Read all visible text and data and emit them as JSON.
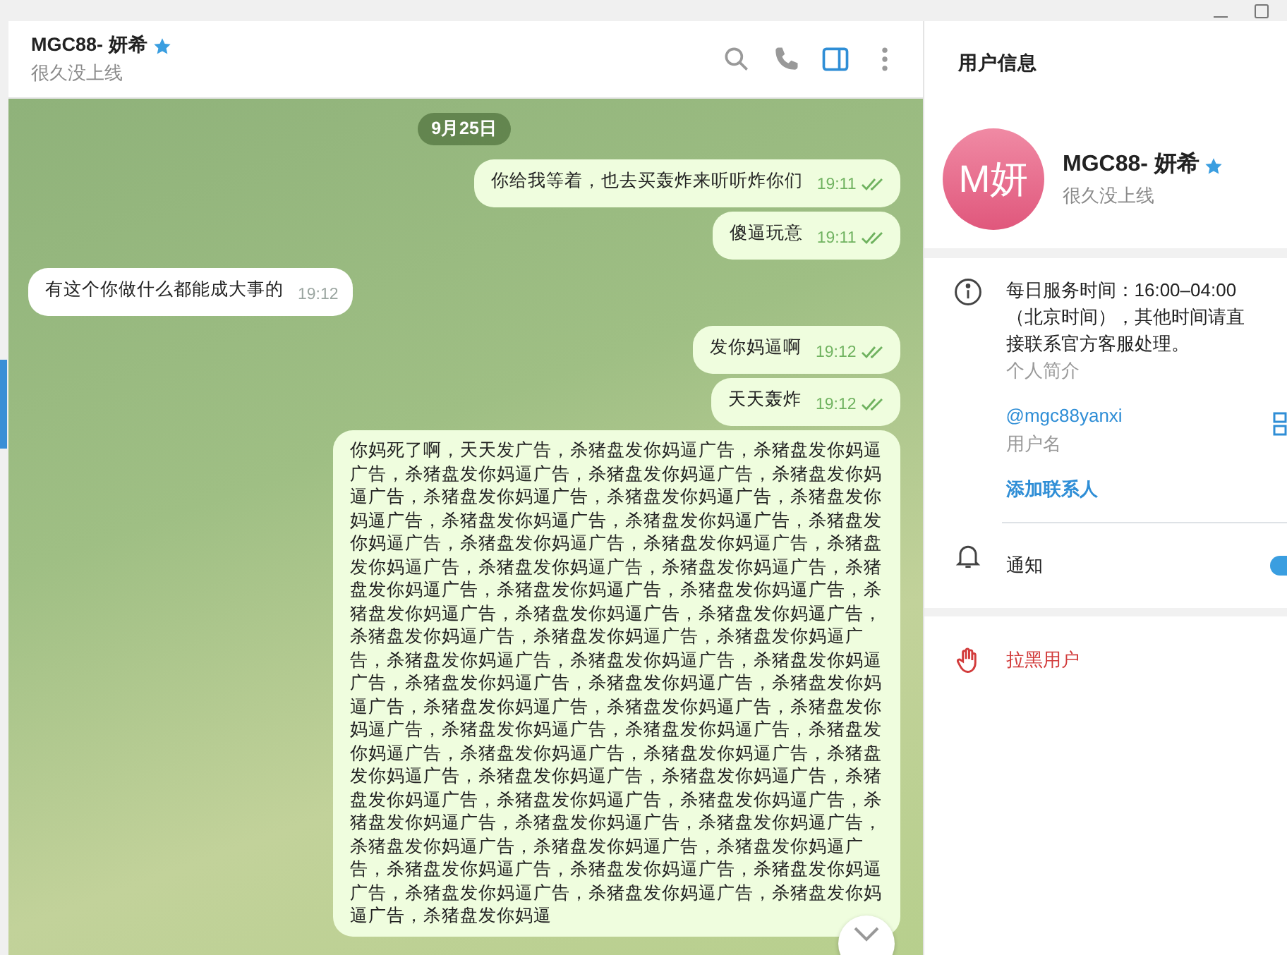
{
  "chat_header": {
    "name": "MGC88- 妍希",
    "verified": true,
    "status": "很久没上线",
    "side_panel_open": true
  },
  "messages": [
    {
      "kind": "date",
      "text": "9月25日"
    },
    {
      "kind": "out",
      "text": "你给我等着，也去买轰炸来听听炸你们",
      "time": "19:11",
      "read": true
    },
    {
      "kind": "out",
      "text": "傻逼玩意",
      "time": "19:11",
      "read": true
    },
    {
      "kind": "in",
      "text": "有这个你做什么都能成大事的",
      "time": "19:12"
    },
    {
      "kind": "out",
      "text": "发你妈逼啊",
      "time": "19:12",
      "read": true
    },
    {
      "kind": "out",
      "text": "天天轰炸",
      "time": "19:12",
      "read": true
    },
    {
      "kind": "long",
      "text": "你妈死了啊，天天发广告，杀猪盘发你妈逼广告，杀猪盘发你妈逼广告，杀猪盘发你妈逼广告，杀猪盘发你妈逼广告，杀猪盘发你妈逼广告，杀猪盘发你妈逼广告，杀猪盘发你妈逼广告，杀猪盘发你妈逼广告，杀猪盘发你妈逼广告，杀猪盘发你妈逼广告，杀猪盘发你妈逼广告，杀猪盘发你妈逼广告，杀猪盘发你妈逼广告，杀猪盘发你妈逼广告，杀猪盘发你妈逼广告，杀猪盘发你妈逼广告，杀猪盘发你妈逼广告，杀猪盘发你妈逼广告，杀猪盘发你妈逼广告，杀猪盘发你妈逼广告，杀猪盘发你妈逼广告，杀猪盘发你妈逼广告，杀猪盘发你妈逼广告，杀猪盘发你妈逼广告，杀猪盘发你妈逼广告，杀猪盘发你妈逼广告，杀猪盘发你妈逼广告，杀猪盘发你妈逼广告，杀猪盘发你妈逼广告，杀猪盘发你妈逼广告，杀猪盘发你妈逼广告，杀猪盘发你妈逼广告，杀猪盘发你妈逼广告，杀猪盘发你妈逼广告，杀猪盘发你妈逼广告，杀猪盘发你妈逼广告，杀猪盘发你妈逼广告，杀猪盘发你妈逼广告，杀猪盘发你妈逼广告，杀猪盘发你妈逼广告，杀猪盘发你妈逼广告，杀猪盘发你妈逼广告，杀猪盘发你妈逼广告，杀猪盘发你妈逼广告，杀猪盘发你妈逼广告，杀猪盘发你妈逼广告，杀猪盘发你妈逼广告，杀猪盘发你妈逼广告，杀猪盘发你妈逼广告，杀猪盘发你妈逼广告，杀猪盘发你妈逼广告，杀猪盘发你妈逼广告，杀猪盘发你妈逼广告，杀猪盘发你妈逼广告，杀猪盘发你妈逼广告，杀猪盘发你妈逼广告，杀猪盘发你妈逼广告，杀猪盘发你妈逼"
    }
  ],
  "profile": {
    "title": "用户信息",
    "avatar_text": "M妍",
    "name": "MGC88- 妍希",
    "verified": true,
    "status": "很久没上线"
  },
  "info": {
    "bio": "每日服务时间：16:00–04:00（北京时间），其他时间请直接联系官方客服处理。",
    "bio_label": "个人简介",
    "username": "@mgc88yanxi",
    "username_label": "用户名",
    "add_contact": "添加联系人"
  },
  "notifications": {
    "label": "通知",
    "on": true
  },
  "block": {
    "label": "拉黑用户"
  }
}
